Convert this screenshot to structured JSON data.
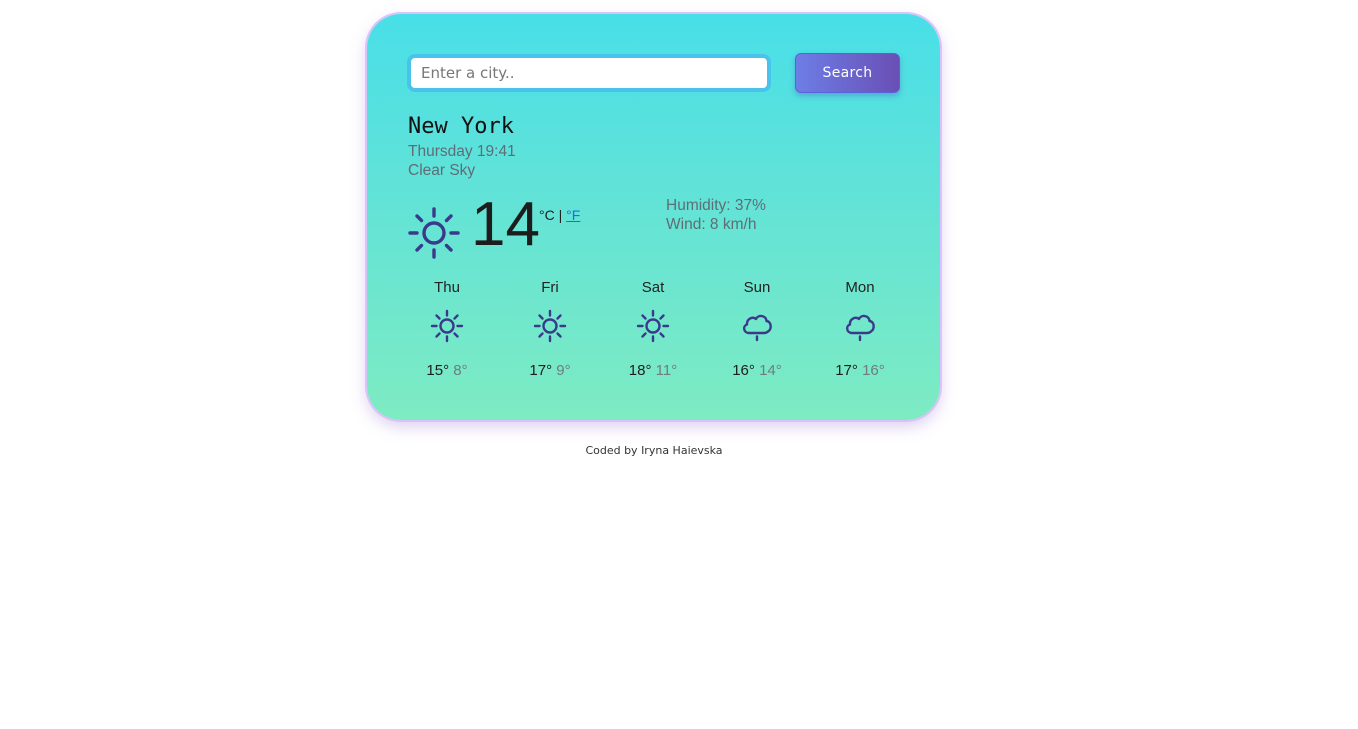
{
  "search": {
    "placeholder": "Enter a city..",
    "button_label": "Search"
  },
  "current": {
    "city": "New York",
    "datetime": "Thursday 19:41",
    "description": "Clear Sky",
    "temperature": "14",
    "unit_celsius": "°C",
    "unit_separator": "|",
    "unit_fahrenheit": "°F",
    "humidity": "Humidity: 37%",
    "wind": "Wind: 8 km/h",
    "icon": "sun-icon"
  },
  "forecast": [
    {
      "day": "Thu",
      "icon": "sun-icon",
      "max": "15°",
      "min": "8°"
    },
    {
      "day": "Fri",
      "icon": "sun-icon",
      "max": "17°",
      "min": "9°"
    },
    {
      "day": "Sat",
      "icon": "sun-icon",
      "max": "18°",
      "min": "11°"
    },
    {
      "day": "Sun",
      "icon": "rain-cloud-icon",
      "max": "16°",
      "min": "14°"
    },
    {
      "day": "Mon",
      "icon": "rain-cloud-icon",
      "max": "17°",
      "min": "16°"
    }
  ],
  "footer": {
    "text": "Coded by Iryna Haievska"
  },
  "colors": {
    "icon": "#3b3a8a",
    "card_top": "#48dfe8",
    "card_bottom": "#7eebc2",
    "button": "#6a68d8",
    "link": "#1b6ee0"
  }
}
